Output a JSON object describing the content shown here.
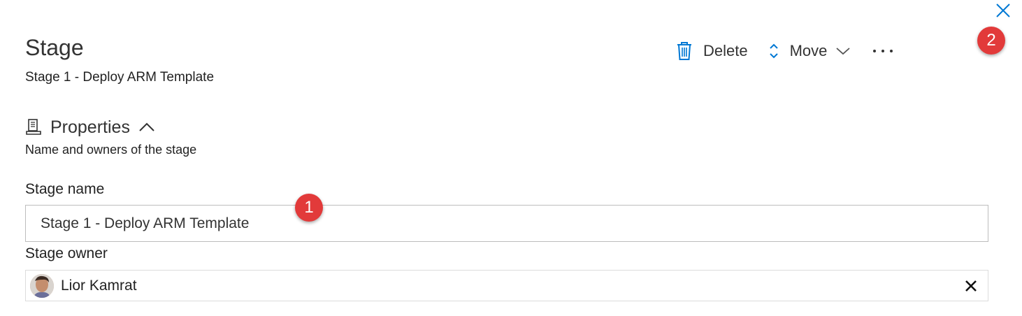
{
  "panel": {
    "title": "Stage",
    "subtitle": "Stage 1 - Deploy ARM Template",
    "close_icon": "close-icon"
  },
  "toolbar": {
    "delete_label": "Delete",
    "delete_icon": "trash-icon",
    "move_label": "Move",
    "move_icon": "up-down-arrows-icon",
    "move_chevron": "chevron-down-icon",
    "more_label": "···"
  },
  "properties": {
    "title": "Properties",
    "icon": "properties-icon",
    "toggle_icon": "chevron-up-icon",
    "description": "Name and owners of the stage"
  },
  "fields": {
    "stage_name": {
      "label": "Stage name",
      "value": "Stage 1 - Deploy ARM Template"
    },
    "stage_owner": {
      "label": "Stage owner",
      "name": "Lior Kamrat",
      "remove_icon": "close-icon"
    }
  },
  "annotations": [
    "1",
    "2"
  ],
  "colors": {
    "accent": "#0078d4",
    "badge": "#e23a3a",
    "text": "#333333"
  }
}
